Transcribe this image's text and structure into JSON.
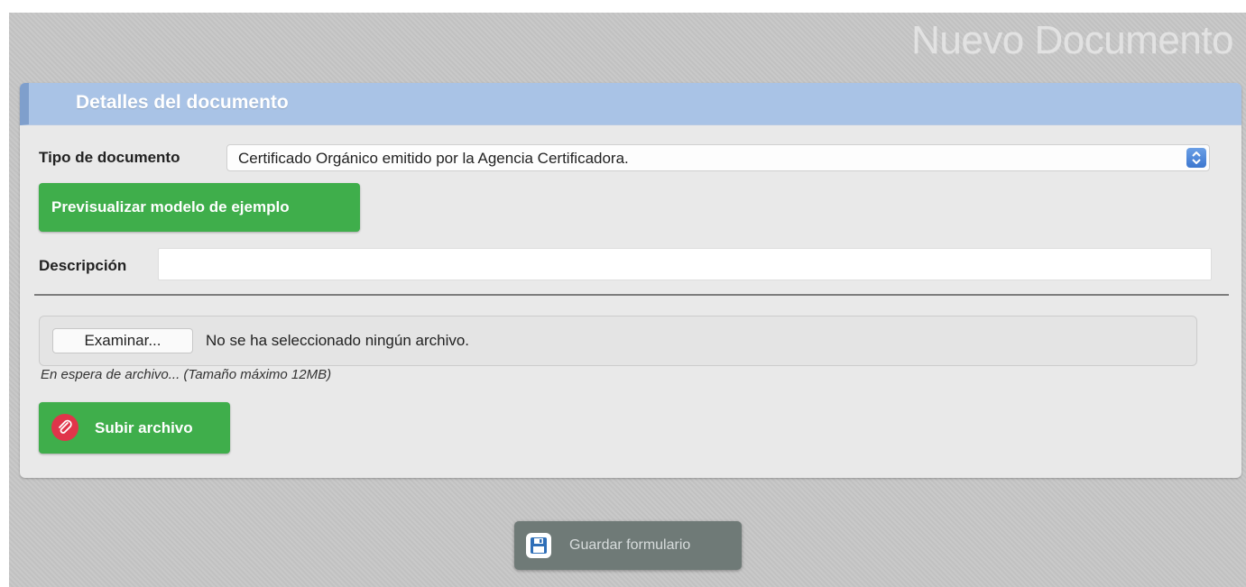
{
  "page_title": "Nuevo Documento",
  "panel": {
    "header_title": "Detalles del documento",
    "doc_type": {
      "label": "Tipo de documento",
      "selected": "Certificado Orgánico emitido por la Agencia Certificadora."
    },
    "preview_button_label": "Previsualizar modelo de ejemplo",
    "description": {
      "label": "Descripción",
      "value": ""
    },
    "file_upload": {
      "browse_label": "Examinar...",
      "status": "No se ha seleccionado ningún archivo.",
      "hint": "En espera de archivo... (Tamaño máximo 12MB)"
    },
    "upload_button_label": "Subir archivo"
  },
  "save_button_label": "Guardar formulario",
  "icons": {
    "select_arrows": "chevron-updown-icon",
    "upload": "paperclip-icon",
    "save": "floppy-disk-icon"
  },
  "colors": {
    "green_button": "#3fae4b",
    "header_blue": "#a9c3e6",
    "upload_icon_red": "#e0354a",
    "save_button": "#6f7a77"
  }
}
